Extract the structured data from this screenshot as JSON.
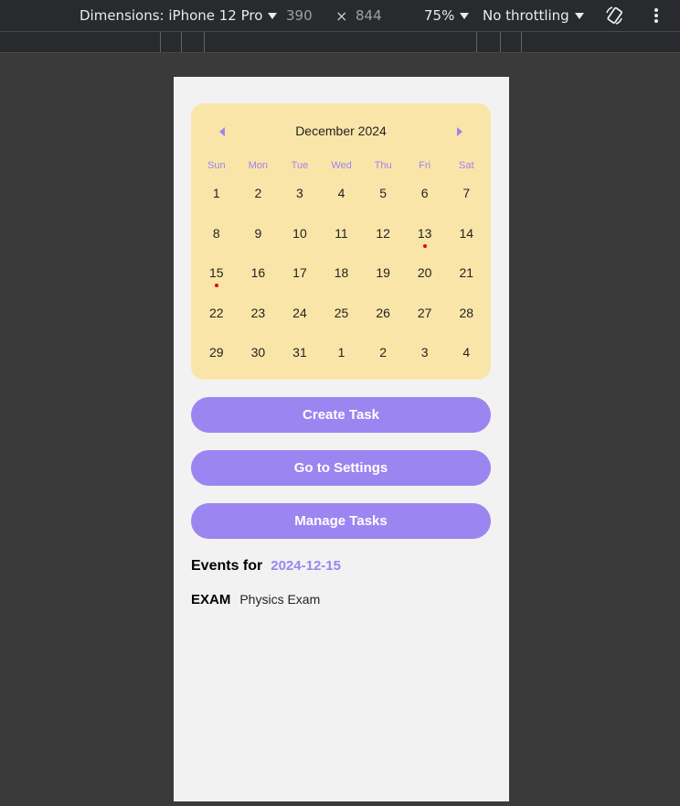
{
  "toolbar": {
    "dimensions_label": "Dimensions: iPhone 12 Pro",
    "width": "390",
    "times": "×",
    "height": "844",
    "zoom": "75%",
    "throttling": "No throttling",
    "rotate_icon": "rotate-icon",
    "more_icon": "more-vertical-icon"
  },
  "calendar": {
    "month": "December 2024",
    "weekdays": [
      "Sun",
      "Mon",
      "Tue",
      "Wed",
      "Thu",
      "Fri",
      "Sat"
    ],
    "weeks": [
      [
        "1",
        "2",
        "3",
        "4",
        "5",
        "6",
        "7"
      ],
      [
        "8",
        "9",
        "10",
        "11",
        "12",
        "13",
        "14"
      ],
      [
        "15",
        "16",
        "17",
        "18",
        "19",
        "20",
        "21"
      ],
      [
        "22",
        "23",
        "24",
        "25",
        "26",
        "27",
        "28"
      ],
      [
        "29",
        "30",
        "31",
        "1",
        "2",
        "3",
        "4"
      ]
    ],
    "event_markers": [
      "13",
      "15"
    ],
    "colors": {
      "background": "#fae5a8",
      "accent": "#9b85f0",
      "marker": "#e0001b"
    }
  },
  "buttons": {
    "create_task": "Create Task",
    "go_to_settings": "Go to Settings",
    "manage_tasks": "Manage Tasks"
  },
  "events": {
    "label": "Events for",
    "date": "2024-12-15",
    "items": [
      {
        "type": "EXAM",
        "title": "Physics Exam"
      }
    ]
  }
}
